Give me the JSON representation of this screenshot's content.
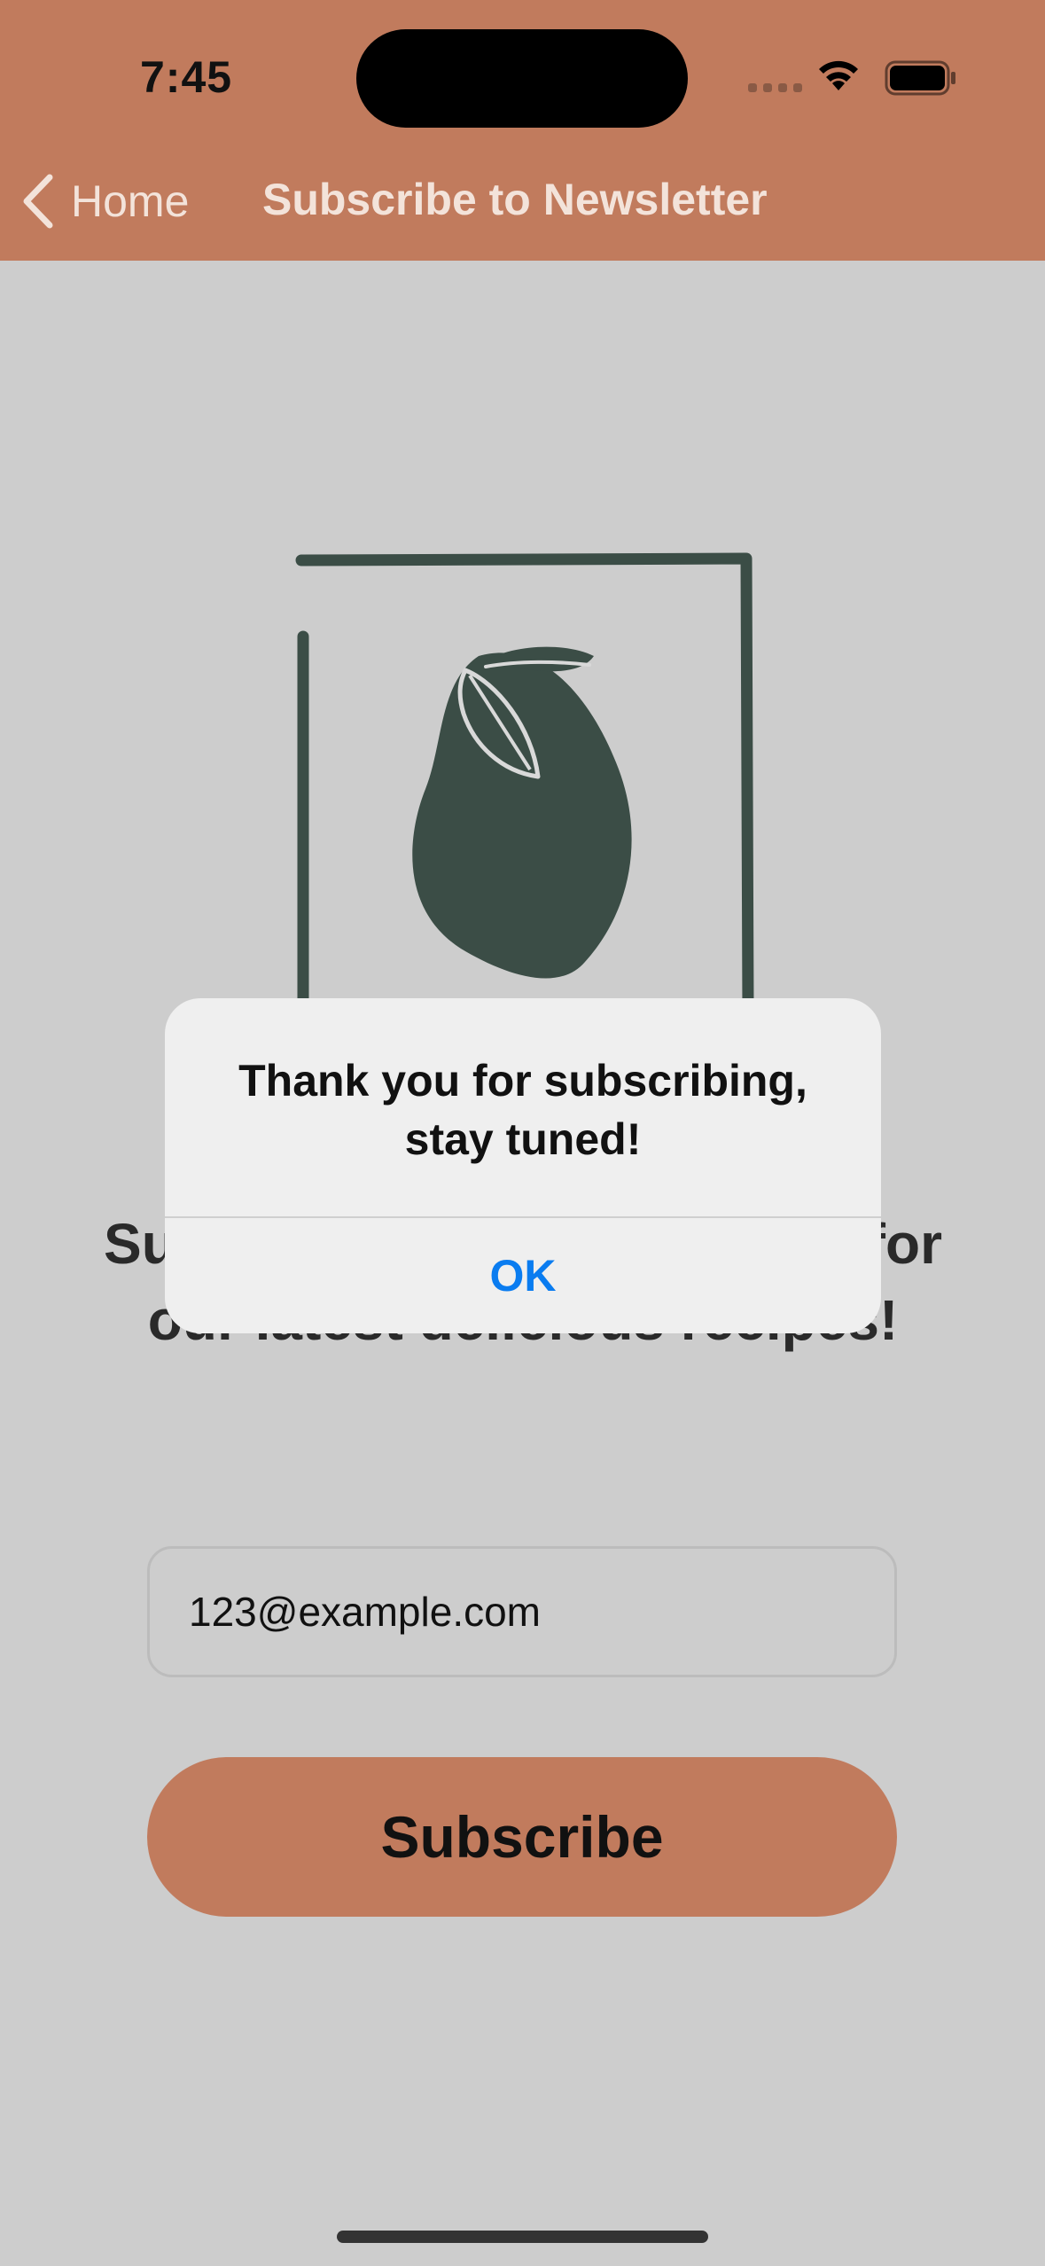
{
  "status_bar": {
    "time": "7:45"
  },
  "nav": {
    "back_label": "Home",
    "title": "Subscribe to Newsletter"
  },
  "main": {
    "headline": "Subscribe to our newsletter for our latest delicious recipes!",
    "email_value": "123@example.com",
    "subscribe_label": "Subscribe"
  },
  "alert": {
    "message": "Thank you for subscribing, stay tuned!",
    "ok_label": "OK"
  },
  "colors": {
    "brand": "#c17b5d",
    "background": "#cdcdcd",
    "logo": "#3b4d46",
    "link_blue": "#0a7cf0"
  },
  "icons": [
    "back-chevron-icon",
    "cellular-signal-icon",
    "wifi-icon",
    "battery-icon",
    "lemon-logo-icon"
  ]
}
